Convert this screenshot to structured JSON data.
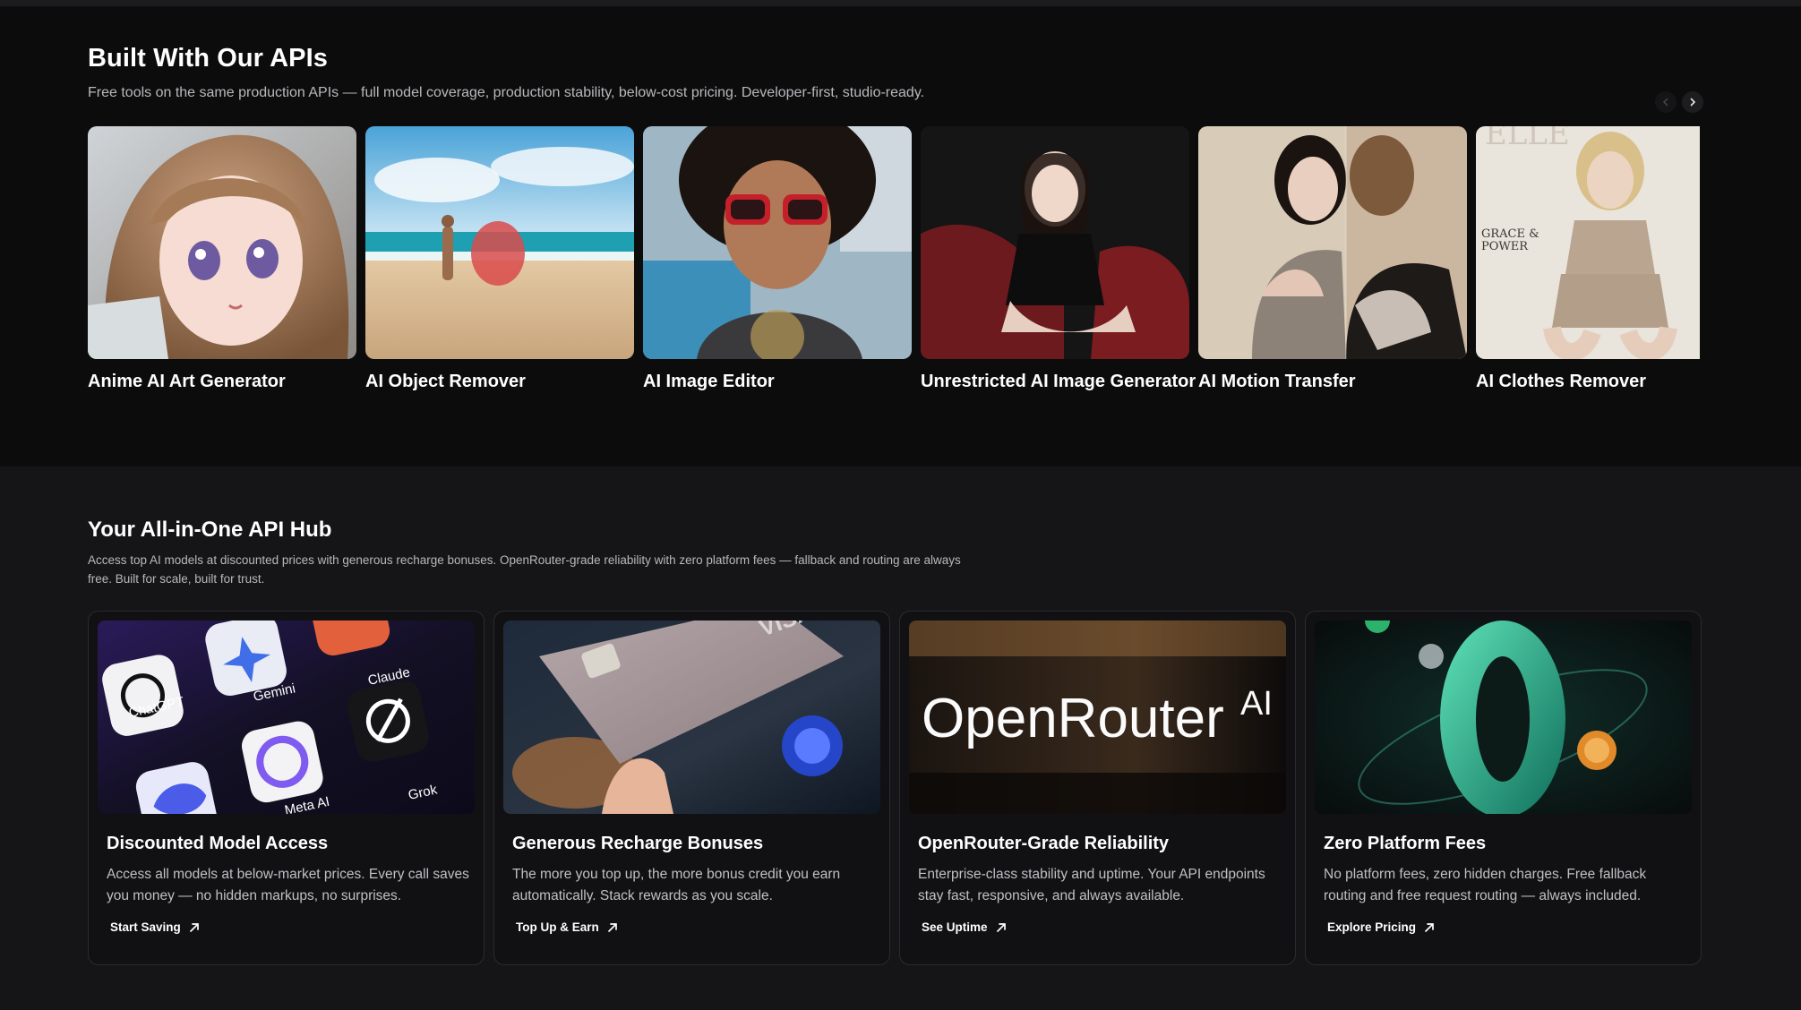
{
  "built": {
    "title": "Built With Our APIs",
    "subtitle": "Free tools on the same production APIs — full model coverage, production stability, below-cost pricing. Developer-first, studio-ready.",
    "tools": [
      {
        "label": "Anime AI Art Generator"
      },
      {
        "label": "AI Object Remover"
      },
      {
        "label": "AI Image Editor"
      },
      {
        "label": "Unrestricted AI Image Generator"
      },
      {
        "label": "AI Motion Transfer"
      },
      {
        "label": "AI Clothes Remover"
      }
    ],
    "nav": {
      "prev_icon": "chevron-left-icon",
      "next_icon": "chevron-right-icon"
    }
  },
  "hub": {
    "title": "Your All-in-One API Hub",
    "description": "Access top AI models at discounted prices with generous recharge bonuses. OpenRouter-grade reliability with zero platform fees — fallback and routing are always free. Built for scale, built for trust.",
    "cards": [
      {
        "title": "Discounted Model Access",
        "description": "Access all models at below-market prices. Every call saves you money — no hidden markups, no surprises.",
        "link": "Start Saving",
        "image_labels": [
          "ChatGPT",
          "Gemini",
          "Claude",
          "Grok",
          "Meta AI"
        ]
      },
      {
        "title": "Generous Recharge Bonuses",
        "description": "The more you top up, the more bonus credit you earn automatically. Stack rewards as you scale.",
        "link": "Top Up & Earn",
        "image_labels": [
          "VISA"
        ]
      },
      {
        "title": "OpenRouter-Grade Reliability",
        "description": "Enterprise-class stability and uptime. Your API endpoints stay fast, responsive, and always available.",
        "link": "See Uptime",
        "image_labels": [
          "OpenRouter",
          "AI"
        ]
      },
      {
        "title": "Zero Platform Fees",
        "description": "No platform fees, zero hidden charges. Free fallback routing and free request routing — always included.",
        "link": "Explore Pricing",
        "image_labels": []
      }
    ]
  },
  "tile_images": {
    "tile_4_magazine_text": "GRACE & POWER"
  },
  "colors": {
    "page_bg": "#0c0c0d",
    "section2_bg": "#151517",
    "card_border": "#2b2b2f",
    "muted_text": "#b9b9bd"
  }
}
